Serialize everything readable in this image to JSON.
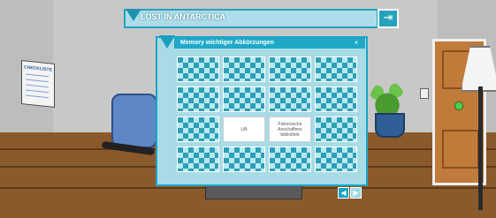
{
  "header": {
    "title": "LOST IN ANTARCTICA",
    "exit_icon": "exit-door-icon"
  },
  "scene": {
    "checklist_title": "CHECKLISTE"
  },
  "modal": {
    "title": "Memory wichtiger Abkürzungen",
    "close_label": "×",
    "grid": {
      "rows": 4,
      "columns": 4,
      "cards": [
        {
          "state": "hidden"
        },
        {
          "state": "hidden"
        },
        {
          "state": "hidden"
        },
        {
          "state": "hidden"
        },
        {
          "state": "hidden"
        },
        {
          "state": "hidden"
        },
        {
          "state": "hidden"
        },
        {
          "state": "hidden"
        },
        {
          "state": "hidden"
        },
        {
          "state": "revealed",
          "text": "LiB"
        },
        {
          "state": "revealed",
          "text": "Fiskorosche Anschaffens bibliothek"
        },
        {
          "state": "hidden"
        },
        {
          "state": "hidden"
        },
        {
          "state": "hidden"
        },
        {
          "state": "hidden"
        },
        {
          "state": "hidden"
        }
      ]
    }
  },
  "navigation": {
    "prev_label": "◀",
    "next_label": "▶"
  },
  "colors": {
    "accent": "#1aa4c5",
    "card_back_light": "#b9e9f2",
    "card_back_dark": "#2d9fb7",
    "floor": "#8b5a2b"
  }
}
